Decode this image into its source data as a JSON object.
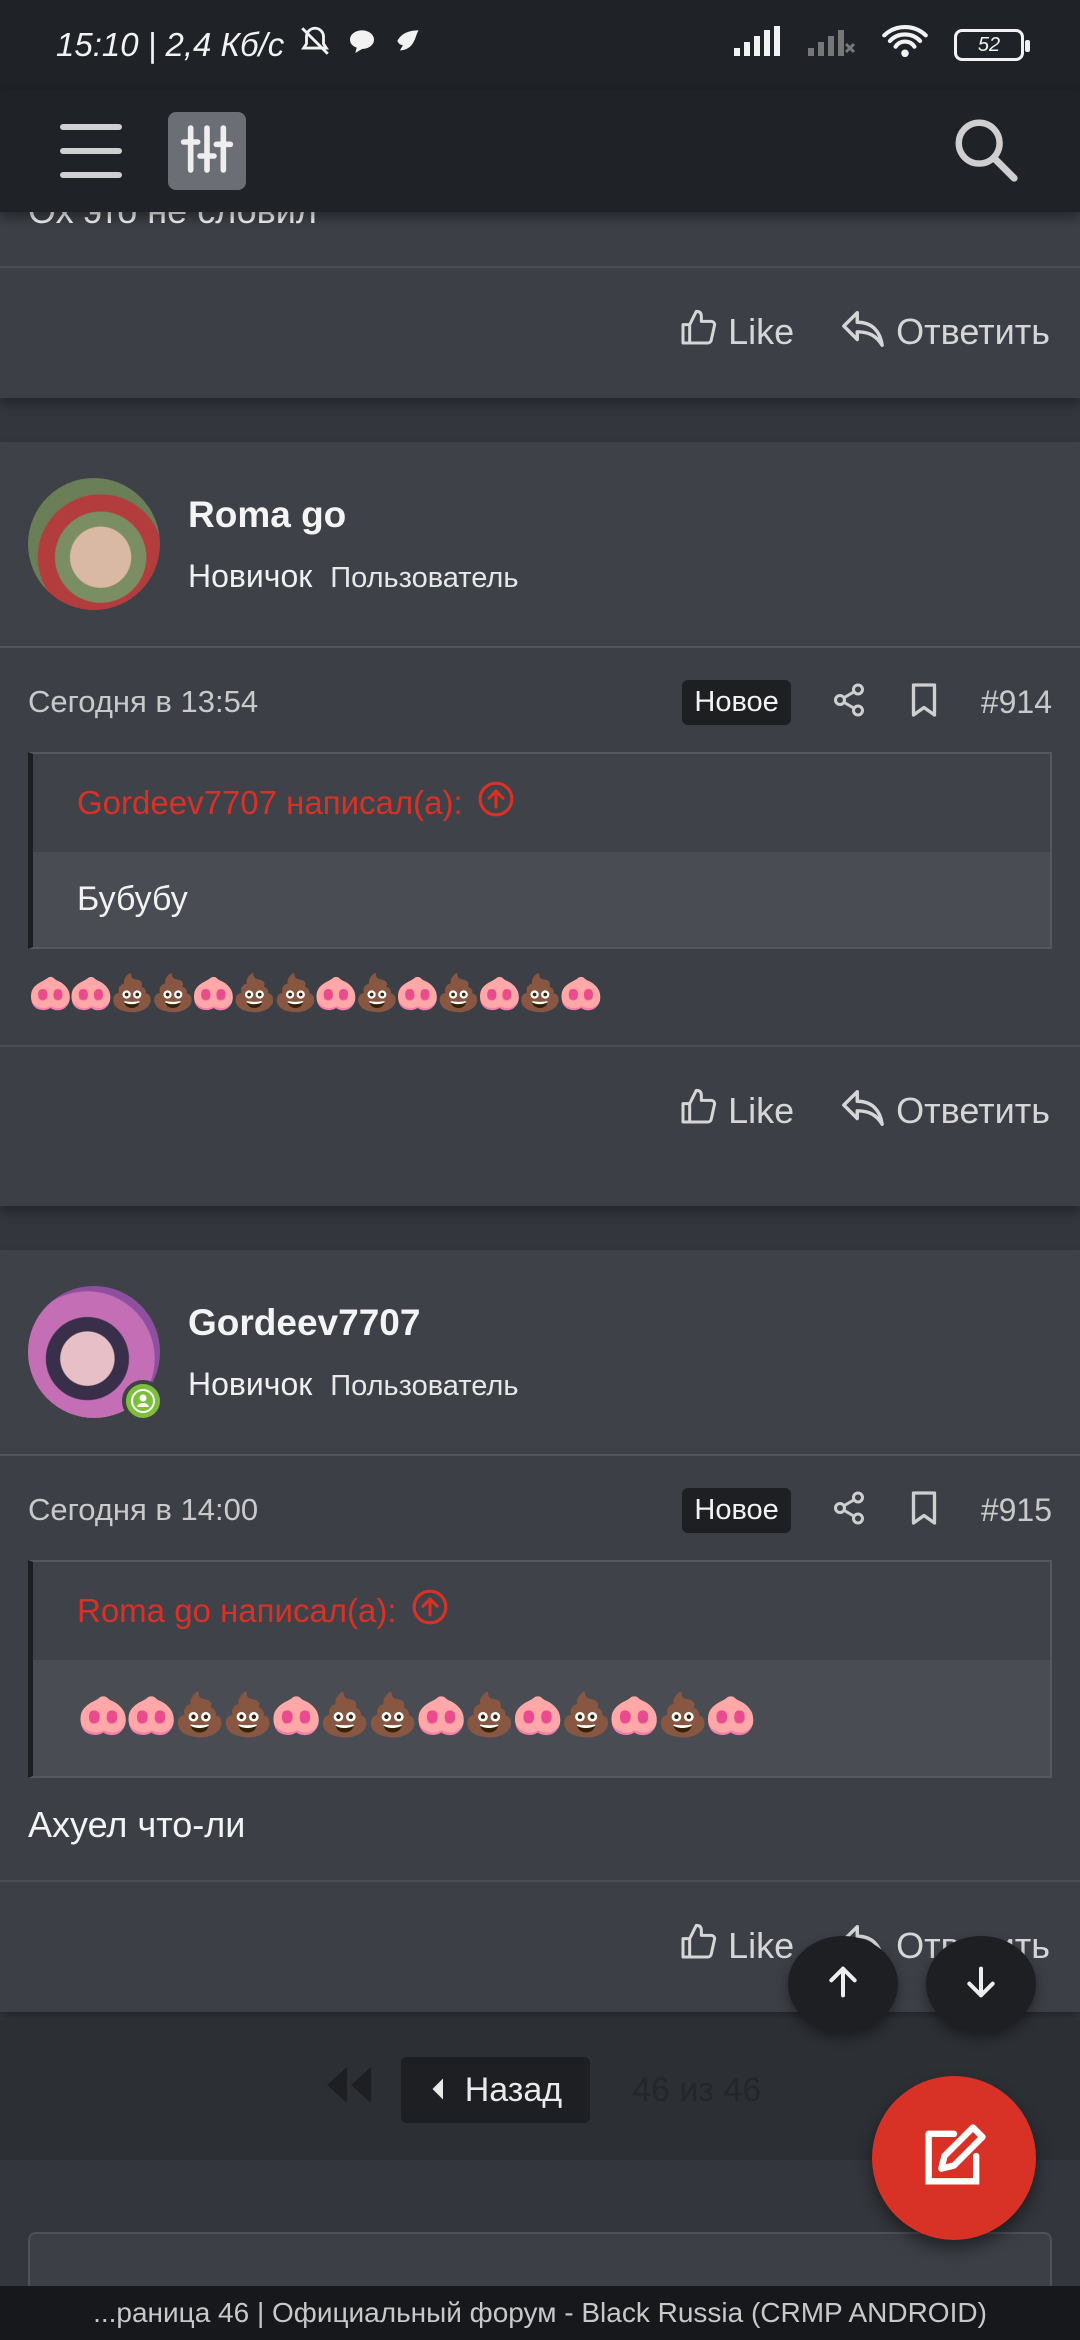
{
  "status_bar": {
    "time_speed": "15:10 | 2,4 Кб/с",
    "battery": "52"
  },
  "posts": [
    {
      "partial_text": "Ох это не словил",
      "like_label": "Like",
      "reply_label": "Ответить"
    },
    {
      "username": "Roma go",
      "role": "Новичок",
      "group": "Пользователь",
      "date": "Сегодня в 13:54",
      "badge": "Новое",
      "number": "#914",
      "quote_author": "Gordeev7707 написал(а):",
      "quote_text": "Бубубу",
      "text": "🐽🐽💩💩🐽💩💩🐽💩🐽💩🐽💩🐽",
      "like_label": "Like",
      "reply_label": "Ответить"
    },
    {
      "username": "Gordeev7707",
      "role": "Новичок",
      "group": "Пользователь",
      "date": "Сегодня в 14:00",
      "badge": "Новое",
      "number": "#915",
      "quote_author": "Roma go написал(а):",
      "quote_text": "🐽🐽💩💩🐽💩💩🐽💩🐽💩🐽💩🐽",
      "text": "Ахуел что-ли",
      "like_label": "Like",
      "reply_label": "Ответить"
    }
  ],
  "pagination": {
    "back_label": "Назад",
    "info": "46 из 46"
  },
  "page_title": "...раница 46 | Официальный форум - Black Russia (CRMP ANDROID)"
}
